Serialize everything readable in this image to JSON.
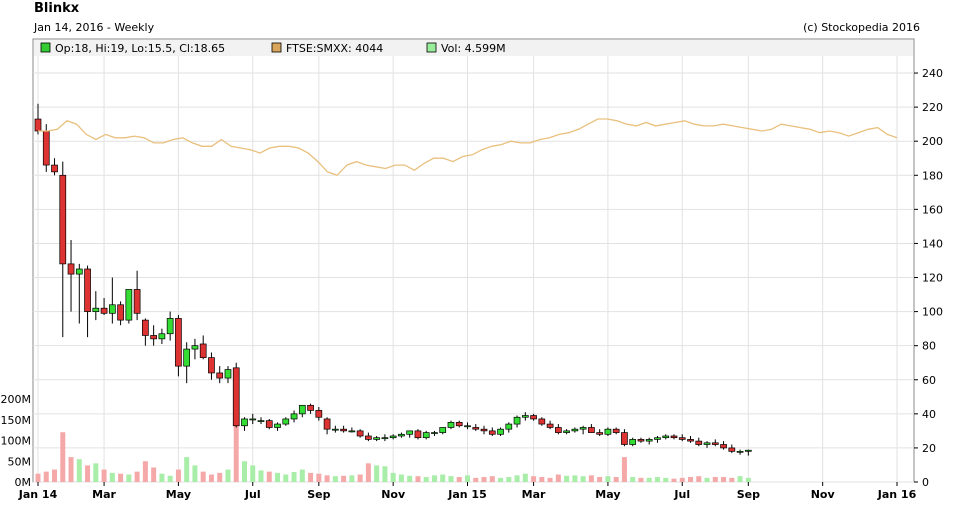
{
  "title": "Blinkx",
  "subtitle": "Jan 14, 2016 - Weekly",
  "copyright": "(c) Stockopedia 2016",
  "legend": [
    {
      "label": "Op:18, Hi:19, Lo:15.5, Cl:18.65",
      "color": "#33cc33"
    },
    {
      "label": "FTSE:SMXX: 4044",
      "color": "#d9a55a"
    },
    {
      "label": "Vol: 4.599M",
      "color": "#99ee99"
    }
  ],
  "chart_data": {
    "type": "candlestick",
    "price_axis": {
      "min": 0,
      "max": 250,
      "ticks": [
        "0",
        "20",
        "40",
        "60",
        "80",
        "100",
        "120",
        "140",
        "160",
        "180",
        "200",
        "220",
        "240"
      ]
    },
    "volume_axis": {
      "min": 0,
      "max": 200000000,
      "ticks": [
        "0M",
        "50M",
        "100M",
        "150M",
        "200M"
      ]
    },
    "x_ticks": [
      {
        "label": "Jan 14",
        "week": 0
      },
      {
        "label": "Mar",
        "week": 8
      },
      {
        "label": "May",
        "week": 17
      },
      {
        "label": "Jul",
        "week": 26
      },
      {
        "label": "Sep",
        "week": 34
      },
      {
        "label": "Nov",
        "week": 43
      },
      {
        "label": "Jan 15",
        "week": 52
      },
      {
        "label": "Mar",
        "week": 60
      },
      {
        "label": "May",
        "week": 69
      },
      {
        "label": "Jul",
        "week": 78
      },
      {
        "label": "Sep",
        "week": 86
      },
      {
        "label": "Nov",
        "week": 95
      },
      {
        "label": "Jan 16",
        "week": 104
      }
    ],
    "candles": [
      [
        213,
        222,
        204,
        206
      ],
      [
        206,
        210,
        182,
        186
      ],
      [
        186,
        190,
        180,
        182
      ],
      [
        180,
        188,
        85,
        128
      ],
      [
        128,
        142,
        100,
        122
      ],
      [
        122,
        128,
        93,
        125
      ],
      [
        125,
        127,
        85,
        100
      ],
      [
        100,
        112,
        95,
        102
      ],
      [
        102,
        108,
        98,
        99
      ],
      [
        99,
        120,
        93,
        104
      ],
      [
        104,
        106,
        92,
        95
      ],
      [
        95,
        108,
        93,
        113
      ],
      [
        113,
        124,
        95,
        99
      ],
      [
        95,
        96,
        80,
        86
      ],
      [
        86,
        92,
        80,
        84
      ],
      [
        84,
        90,
        81,
        87
      ],
      [
        87,
        100,
        83,
        96
      ],
      [
        96,
        98,
        62,
        68
      ],
      [
        68,
        82,
        58,
        78
      ],
      [
        78,
        84,
        72,
        80
      ],
      [
        81,
        86,
        72,
        73
      ],
      [
        73,
        76,
        60,
        64
      ],
      [
        64,
        68,
        58,
        61
      ],
      [
        61,
        68,
        58,
        66
      ],
      [
        67,
        70,
        32,
        33
      ],
      [
        33,
        38,
        30,
        37
      ],
      [
        37,
        40,
        34,
        37
      ],
      [
        36,
        38,
        34,
        36
      ],
      [
        36,
        37,
        31,
        32
      ],
      [
        32,
        35,
        30,
        34
      ],
      [
        34,
        38,
        33,
        37
      ],
      [
        37,
        42,
        35,
        40
      ],
      [
        40,
        45,
        38,
        45
      ],
      [
        45,
        46,
        40,
        42
      ],
      [
        42,
        44,
        36,
        38
      ],
      [
        37,
        38,
        28,
        31
      ],
      [
        31,
        33,
        29,
        31
      ],
      [
        31,
        33,
        29,
        30
      ],
      [
        30,
        32,
        29,
        30
      ],
      [
        30,
        31,
        26,
        27
      ],
      [
        27,
        29,
        24,
        25
      ],
      [
        25,
        27,
        24,
        26
      ],
      [
        26,
        28,
        24,
        26
      ],
      [
        26,
        28,
        25,
        27
      ],
      [
        27,
        29,
        26,
        28
      ],
      [
        28,
        30,
        26,
        30
      ],
      [
        30,
        31,
        25,
        26
      ],
      [
        26,
        30,
        25,
        29
      ],
      [
        29,
        30,
        27,
        29
      ],
      [
        29,
        32,
        28,
        32
      ],
      [
        32,
        36,
        31,
        35
      ],
      [
        35,
        36,
        32,
        33
      ],
      [
        33,
        35,
        31,
        33
      ],
      [
        32,
        34,
        30,
        31
      ],
      [
        31,
        33,
        28,
        30
      ],
      [
        30,
        32,
        27,
        28
      ],
      [
        28,
        32,
        27,
        31
      ],
      [
        31,
        35,
        29,
        34
      ],
      [
        34,
        39,
        32,
        38
      ],
      [
        38,
        41,
        36,
        39
      ],
      [
        39,
        40,
        36,
        37
      ],
      [
        37,
        38,
        33,
        34
      ],
      [
        34,
        36,
        31,
        32
      ],
      [
        32,
        34,
        28,
        29
      ],
      [
        29,
        31,
        28,
        30
      ],
      [
        30,
        32,
        29,
        31
      ],
      [
        31,
        33,
        28,
        32
      ],
      [
        32,
        34,
        29,
        29
      ],
      [
        29,
        31,
        27,
        28
      ],
      [
        28,
        32,
        27,
        31
      ],
      [
        31,
        32,
        28,
        29
      ],
      [
        29,
        31,
        21,
        22
      ],
      [
        22,
        26,
        21,
        25
      ],
      [
        25,
        26,
        23,
        24
      ],
      [
        24,
        26,
        22,
        25
      ],
      [
        25,
        27,
        23,
        26
      ],
      [
        26,
        28,
        25,
        27
      ],
      [
        27,
        28,
        25,
        26
      ],
      [
        26,
        28,
        24,
        25
      ],
      [
        25,
        27,
        23,
        24
      ],
      [
        24,
        26,
        21,
        22
      ],
      [
        22,
        24,
        20,
        23
      ],
      [
        23,
        25,
        21,
        22
      ],
      [
        22,
        24,
        19,
        20
      ],
      [
        20,
        22,
        17,
        18
      ],
      [
        18,
        19,
        16,
        18
      ],
      [
        18,
        19,
        15.5,
        18.65
      ]
    ],
    "index_series": [
      206,
      206,
      207,
      212,
      210,
      204,
      201,
      204,
      202,
      202,
      203,
      202,
      199,
      199,
      201,
      202,
      199,
      197,
      197,
      201,
      197,
      196,
      195,
      193,
      196,
      197,
      197,
      196,
      193,
      188,
      182,
      180,
      186,
      188,
      186,
      185,
      184,
      186,
      186,
      183,
      187,
      190,
      190,
      188,
      191,
      192,
      195,
      197,
      198,
      200,
      199,
      199,
      201,
      202,
      204,
      205,
      207,
      210,
      213,
      213,
      212,
      210,
      209,
      211,
      209,
      210,
      211,
      212,
      210,
      209,
      209,
      210,
      209,
      208,
      207,
      206,
      207,
      210,
      209,
      208,
      207,
      205,
      206,
      205,
      203,
      205,
      207,
      208,
      204,
      202
    ],
    "volume": [
      20,
      25,
      30,
      120,
      60,
      55,
      40,
      45,
      30,
      22,
      20,
      18,
      25,
      50,
      35,
      20,
      15,
      30,
      60,
      40,
      25,
      18,
      22,
      30,
      145,
      50,
      40,
      28,
      25,
      22,
      18,
      24,
      30,
      22,
      20,
      16,
      14,
      15,
      16,
      18,
      45,
      40,
      38,
      22,
      18,
      15,
      14,
      12,
      16,
      18,
      14,
      12,
      16,
      10,
      12,
      14,
      10,
      12,
      16,
      20,
      14,
      12,
      10,
      18,
      15,
      16,
      14,
      16,
      12,
      14,
      12,
      60,
      12,
      10,
      10,
      12,
      10,
      8,
      10,
      12,
      14,
      10,
      12,
      12,
      10,
      14,
      10
    ]
  }
}
